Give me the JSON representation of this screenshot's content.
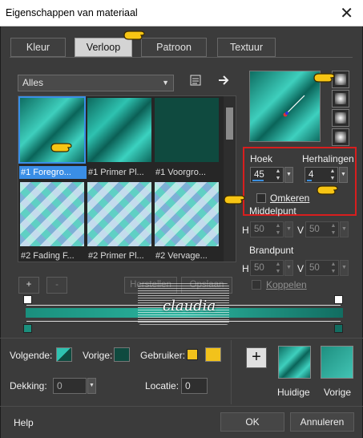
{
  "window": {
    "title": "Eigenschappen van materiaal",
    "close": "✕"
  },
  "tabs": [
    {
      "label": "Kleur"
    },
    {
      "label": "Verloop",
      "active": true
    },
    {
      "label": "Patroon"
    },
    {
      "label": "Textuur"
    }
  ],
  "category": {
    "value": "Alles"
  },
  "thumbs": [
    {
      "caption": "#1 Foregro...",
      "style": "teal",
      "selected": true
    },
    {
      "caption": "#1 Primer Pl...",
      "style": "teal2"
    },
    {
      "caption": "#1 Voorgro...",
      "style": "dark"
    },
    {
      "caption": "#2 Fading F...",
      "style": "check"
    },
    {
      "caption": "#2 Primer Pl...",
      "style": "check"
    },
    {
      "caption": "#2 Vervage...",
      "style": "check"
    }
  ],
  "params": {
    "angle_label": "Hoek",
    "angle_value": "45",
    "repeats_label": "Herhalingen",
    "repeats_value": "4",
    "invert_label": "Omkeren",
    "center_label": "Middelpunt",
    "center_h": "50",
    "center_v": "50",
    "focal_label": "Brandpunt",
    "focal_h": "50",
    "focal_v": "50",
    "link_label": "Koppelen",
    "h": "H",
    "v": "V"
  },
  "editor": {
    "add": "+",
    "remove": "-",
    "reset": "Herstellen",
    "save": "Opslaan"
  },
  "watermark": "claudia",
  "bottom": {
    "next_label": "Volgende:",
    "prev_label": "Vorige:",
    "user_label": "Gebruiker:",
    "opacity_label": "Dekking:",
    "opacity_value": "0",
    "location_label": "Locatie:",
    "location_value": "0",
    "current_label": "Huidige",
    "previous_label": "Vorige",
    "plus": "+"
  },
  "footer": {
    "help": "Help",
    "ok": "OK",
    "cancel": "Annuleren"
  },
  "colors": {
    "accent": "#3a8ee6",
    "highlight": "#d81e1e",
    "teal": "#1a8f7d",
    "user_swatch": "#f2c21b",
    "dark_swatch": "#0f4a3f"
  }
}
